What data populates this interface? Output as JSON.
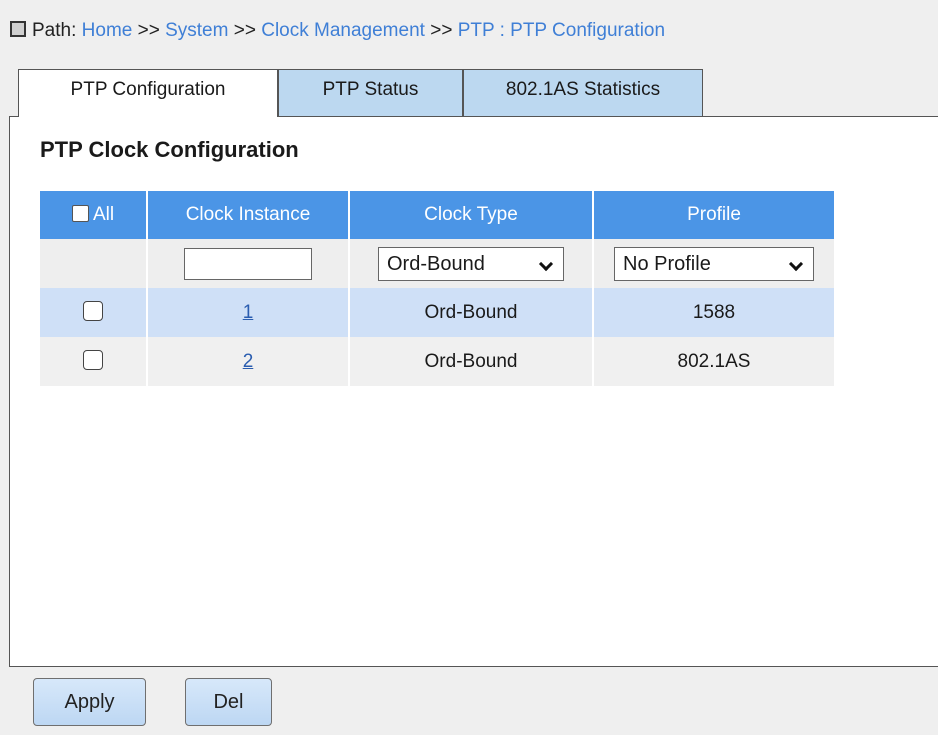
{
  "breadcrumb": {
    "prefix": "Path:",
    "items": [
      "Home",
      "System",
      "Clock Management",
      "PTP"
    ],
    "separator": ">>",
    "current_sep": ":",
    "current": "PTP Configuration"
  },
  "tabs": [
    {
      "label": "PTP Configuration",
      "active": true
    },
    {
      "label": "PTP Status",
      "active": false
    },
    {
      "label": "802.1AS Statistics",
      "active": false
    }
  ],
  "section_title": "PTP Clock Configuration",
  "table": {
    "headers": {
      "select_all": "All",
      "instance": "Clock Instance",
      "type": "Clock Type",
      "profile": "Profile"
    },
    "filter": {
      "instance_value": "",
      "type_selected": "Ord-Bound",
      "profile_selected": "No Profile"
    },
    "rows": [
      {
        "instance": "1",
        "type": "Ord-Bound",
        "profile": "1588",
        "checked": false
      },
      {
        "instance": "2",
        "type": "Ord-Bound",
        "profile": "802.1AS",
        "checked": false
      }
    ]
  },
  "buttons": {
    "apply": "Apply",
    "del": "Del"
  },
  "colors": {
    "header_bg": "#4b95e6",
    "selected_row": "#cfe0f7",
    "tab_bg": "#bcd8f0",
    "link": "#3f7fd6"
  }
}
